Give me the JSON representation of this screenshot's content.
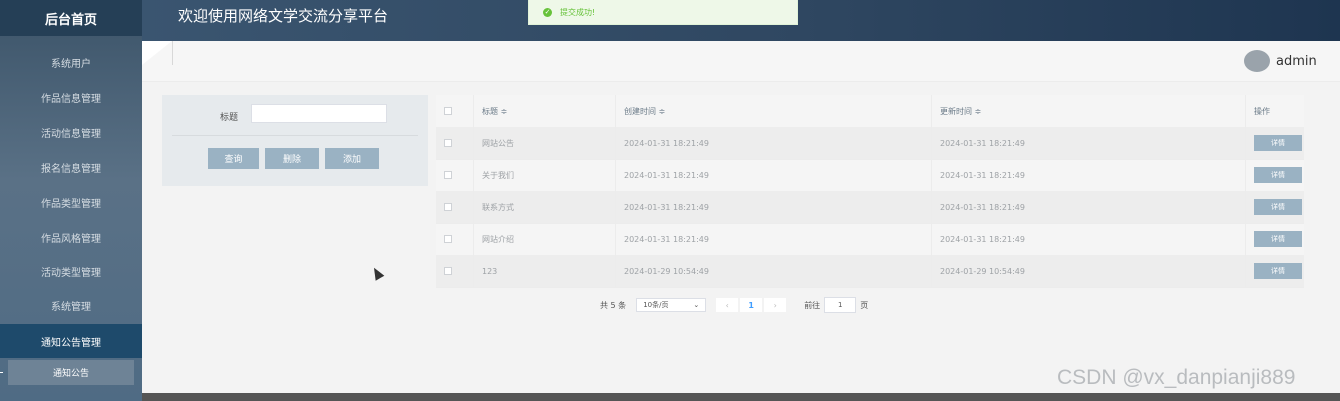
{
  "sidebar": {
    "brand": "后台首页",
    "items": [
      {
        "label": "系统用户"
      },
      {
        "label": "作品信息管理"
      },
      {
        "label": "活动信息管理"
      },
      {
        "label": "报名信息管理"
      },
      {
        "label": "作品类型管理"
      },
      {
        "label": "作品风格管理"
      },
      {
        "label": "活动类型管理"
      },
      {
        "label": "系统管理"
      },
      {
        "label": "通知公告管理"
      }
    ],
    "sub_item": "通知公告"
  },
  "header": {
    "title": "欢迎使用网络文学交流分享平台",
    "username": "admin"
  },
  "toast": {
    "message": "提交成功!"
  },
  "search": {
    "title_label": "标题",
    "title_value": "",
    "buttons": {
      "query": "查询",
      "delete": "删除",
      "add": "添加"
    }
  },
  "table": {
    "headers": {
      "title": "标题 ≑",
      "created": "创建时间 ≑",
      "updated": "更新时间 ≑",
      "action": "操作"
    },
    "rows": [
      {
        "title": "网站公告",
        "created": "2024-01-31 18:21:49",
        "updated": "2024-01-31 18:21:49",
        "action": "详情"
      },
      {
        "title": "关于我们",
        "created": "2024-01-31 18:21:49",
        "updated": "2024-01-31 18:21:49",
        "action": "详情"
      },
      {
        "title": "联系方式",
        "created": "2024-01-31 18:21:49",
        "updated": "2024-01-31 18:21:49",
        "action": "详情"
      },
      {
        "title": "网站介绍",
        "created": "2024-01-31 18:21:49",
        "updated": "2024-01-31 18:21:49",
        "action": "详情"
      },
      {
        "title": "123",
        "created": "2024-01-29 10:54:49",
        "updated": "2024-01-29 10:54:49",
        "action": "详情"
      }
    ]
  },
  "pagination": {
    "total": "共 5 条",
    "page_size": "10条/页",
    "current_page": "1",
    "goto_label": "前往",
    "goto_value": "1",
    "page_unit": "页"
  },
  "watermark": "CSDN @vx_danpianji889",
  "colors": {
    "accent": "#9ab2c3",
    "success": "#67c23a",
    "active_menu": "#1e4a6b"
  }
}
